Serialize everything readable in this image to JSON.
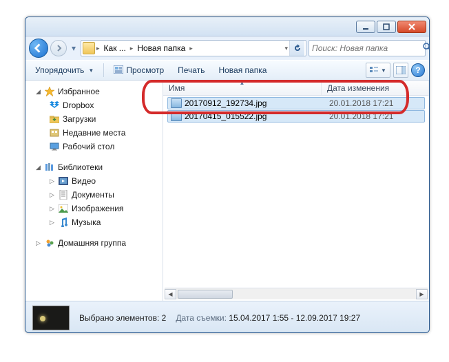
{
  "breadcrumb": {
    "seg1": "Как ...",
    "seg2": "Новая папка"
  },
  "search": {
    "placeholder": "Поиск: Новая папка"
  },
  "toolbar": {
    "organize": "Упорядочить",
    "preview": "Просмотр",
    "print": "Печать",
    "newfolder": "Новая папка"
  },
  "columns": {
    "name": "Имя",
    "date": "Дата изменения"
  },
  "sidebar": {
    "favorites": "Избранное",
    "dropbox": "Dropbox",
    "downloads": "Загрузки",
    "recent": "Недавние места",
    "desktop": "Рабочий стол",
    "libraries": "Библиотеки",
    "video": "Видео",
    "documents": "Документы",
    "pictures": "Изображения",
    "music": "Музыка",
    "homegroup": "Домашняя группа"
  },
  "files": [
    {
      "name": "20170912_192734.jpg",
      "date": "20.01.2018 17:21"
    },
    {
      "name": "20170415_015522.jpg",
      "date": "20.01.2018 17:21"
    }
  ],
  "details": {
    "selected": "Выбрано элементов: 2",
    "shot_label": "Дата съемки:",
    "shot_value": "15.04.2017 1:55 - 12.09.2017 19:27"
  }
}
